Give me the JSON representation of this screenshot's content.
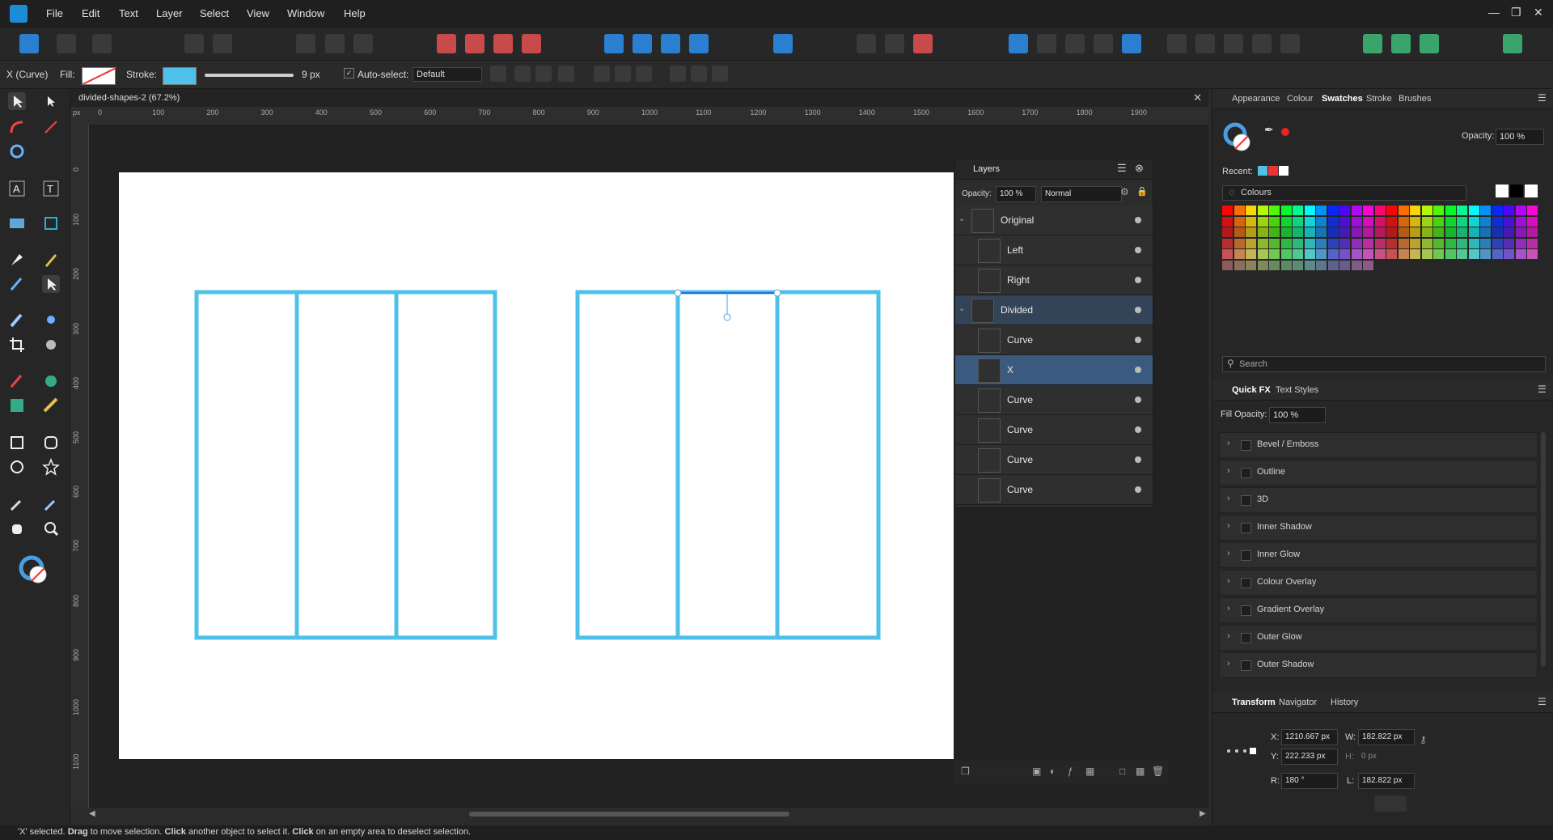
{
  "menu": [
    "File",
    "Edit",
    "Text",
    "Layer",
    "Select",
    "View",
    "Window",
    "Help"
  ],
  "context": {
    "selection_label": "X (Curve)",
    "fill_label": "Fill:",
    "stroke_label": "Stroke:",
    "stroke_width": "9 px",
    "autoselect_label": "Auto-select:",
    "autoselect_value": "Default",
    "stroke_color": "#4fc1e9"
  },
  "document": {
    "tab_title": "divided-shapes-2 (67.2%)",
    "ruler_unit": "px",
    "ruler_h": [
      "0",
      "100",
      "200",
      "300",
      "400",
      "500",
      "600",
      "700",
      "800",
      "900",
      "1000",
      "1100",
      "1200",
      "1300",
      "1400",
      "1500",
      "1600",
      "1700",
      "1800",
      "1900"
    ],
    "ruler_v": [
      "0",
      "100",
      "200",
      "300",
      "400",
      "500",
      "600",
      "700",
      "800",
      "900",
      "1000",
      "1100"
    ]
  },
  "layers": {
    "title": "Layers",
    "opacity_label": "Opacity:",
    "opacity_value": "100 %",
    "blend_mode": "Normal",
    "rows": [
      {
        "name": "Original"
      },
      {
        "name": "Left"
      },
      {
        "name": "Right"
      },
      {
        "name": "Divided"
      },
      {
        "name": "Curve"
      },
      {
        "name": "X"
      },
      {
        "name": "Curve"
      },
      {
        "name": "Curve"
      },
      {
        "name": "Curve"
      },
      {
        "name": "Curve"
      }
    ]
  },
  "swatches_panel": {
    "tabs": [
      "Appearance",
      "Colour",
      "Swatches",
      "Stroke",
      "Brushes"
    ],
    "active_tab": "Swatches",
    "opacity_label": "Opacity:",
    "opacity_value": "100 %",
    "recent_label": "Recent:",
    "palette_name": "Colours",
    "search_placeholder": "Search"
  },
  "fx_panel": {
    "tabs": [
      "Quick FX",
      "Text Styles"
    ],
    "fill_opacity_label": "Fill Opacity:",
    "fill_opacity_value": "100 %",
    "effects": [
      "Bevel / Emboss",
      "Outline",
      "3D",
      "Inner Shadow",
      "Inner Glow",
      "Colour Overlay",
      "Gradient Overlay",
      "Outer Glow",
      "Outer Shadow"
    ]
  },
  "transform_panel": {
    "tabs": [
      "Transform",
      "Navigator",
      "History"
    ],
    "x_label": "X:",
    "x_value": "1210.667 px",
    "y_label": "Y:",
    "y_value": "222.233 px",
    "w_label": "W:",
    "w_value": "182.822 px",
    "h_label": "H:",
    "h_value": "0 px",
    "r_label": "R:",
    "r_value": "180 °",
    "l_label": "L:",
    "l_value": "182.822 px"
  },
  "status": {
    "part1": "'X' selected. ",
    "drag": "Drag",
    "part2": " to move selection. ",
    "click": "Click",
    "part3": " another object to select it. ",
    "click2": "Click",
    "part4": " on an empty area to deselect selection."
  }
}
